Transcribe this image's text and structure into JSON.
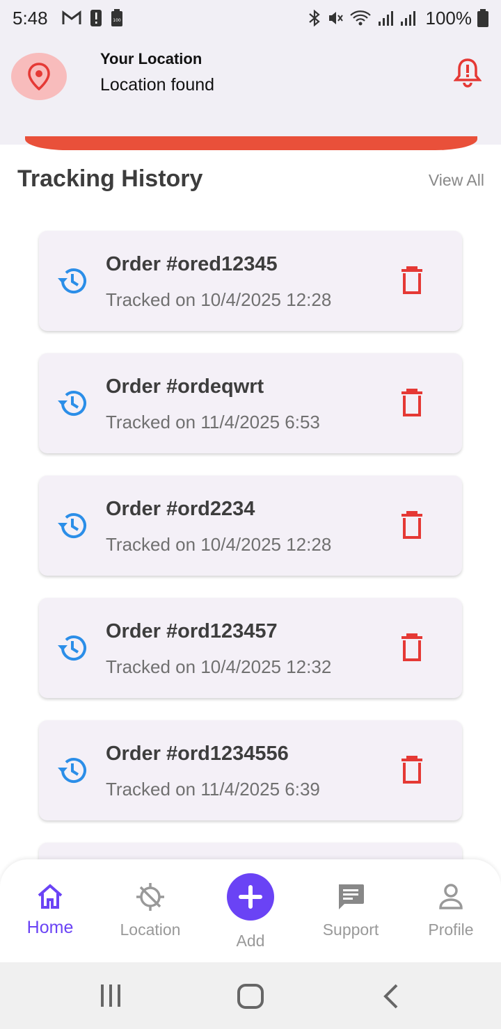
{
  "status_bar": {
    "time": "5:48",
    "battery_percent": "100%",
    "icons": [
      "gmail-icon",
      "alert-icon",
      "battery-small-icon",
      "bluetooth-icon",
      "mute-icon",
      "wifi-icon",
      "signal-icon",
      "signal-icon",
      "battery-icon"
    ]
  },
  "location": {
    "title": "Your Location",
    "status": "Location found",
    "icons": [
      "location-pin-icon",
      "alert-bell-icon"
    ]
  },
  "history": {
    "title": "Tracking History",
    "view_all": "View All",
    "items": [
      {
        "order": "Order #ored12345",
        "tracked": "Tracked on 10/4/2025 12:28"
      },
      {
        "order": "Order #ordeqwrt",
        "tracked": "Tracked on 11/4/2025 6:53"
      },
      {
        "order": "Order #ord2234",
        "tracked": "Tracked on 10/4/2025 12:28"
      },
      {
        "order": "Order #ord123457",
        "tracked": "Tracked on 10/4/2025 12:32"
      },
      {
        "order": "Order #ord1234556",
        "tracked": "Tracked on 11/4/2025 6:39"
      }
    ]
  },
  "nav": {
    "home": "Home",
    "location": "Location",
    "add": "Add",
    "support": "Support",
    "profile": "Profile"
  },
  "colors": {
    "accent": "#6a43f5",
    "danger": "#e53935",
    "history_icon": "#2b8ee8",
    "header_bg": "#f1eff5",
    "card_bg": "#f4f0f7"
  }
}
